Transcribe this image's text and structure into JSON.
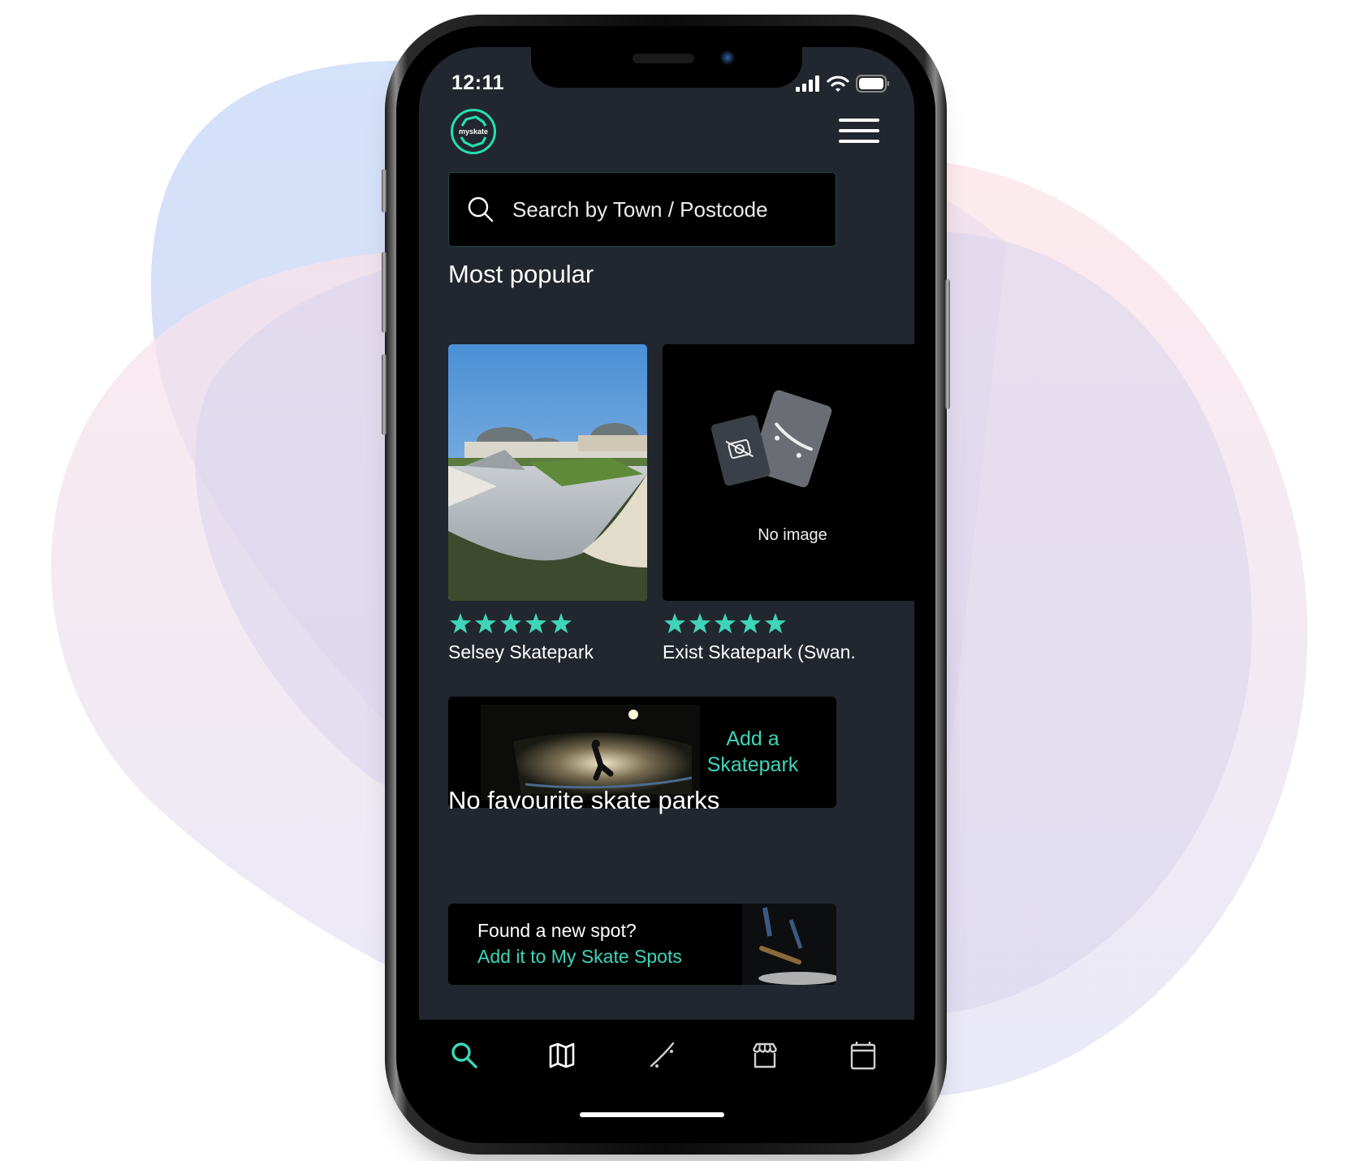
{
  "status_bar": {
    "time": "12:11"
  },
  "app": {
    "logo_text": "myskate",
    "accent_color": "#22e0b0"
  },
  "search": {
    "placeholder": "Search by Town / Postcode",
    "value": ""
  },
  "sections": {
    "popular_heading": "Most popular",
    "favourites_heading": "No favourite skate parks"
  },
  "popular_parks": [
    {
      "name": "Selsey Skatepark",
      "rating": 5,
      "max_rating": 5,
      "has_image": true
    },
    {
      "name": "Exist Skatepark (Swan.",
      "rating": 5,
      "max_rating": 5,
      "has_image": false,
      "no_image_label": "No image"
    }
  ],
  "add_banner": {
    "label_line1": "Add a",
    "label_line2": "Skatepark"
  },
  "spot_card": {
    "question": "Found a new spot?",
    "link": "Add it to My Skate Spots"
  },
  "bottom_nav": [
    {
      "id": "search",
      "icon": "search-icon",
      "active": true
    },
    {
      "id": "map",
      "icon": "map-icon",
      "active": false
    },
    {
      "id": "skateboard",
      "icon": "skateboard-icon",
      "active": false
    },
    {
      "id": "shop",
      "icon": "shop-icon",
      "active": false
    },
    {
      "id": "calendar",
      "icon": "calendar-icon",
      "active": false
    }
  ],
  "colors": {
    "accent": "#3ed5b9",
    "screen_bg": "#22262e",
    "card_bg": "#000000",
    "inactive_icon": "#d0d0d0"
  }
}
